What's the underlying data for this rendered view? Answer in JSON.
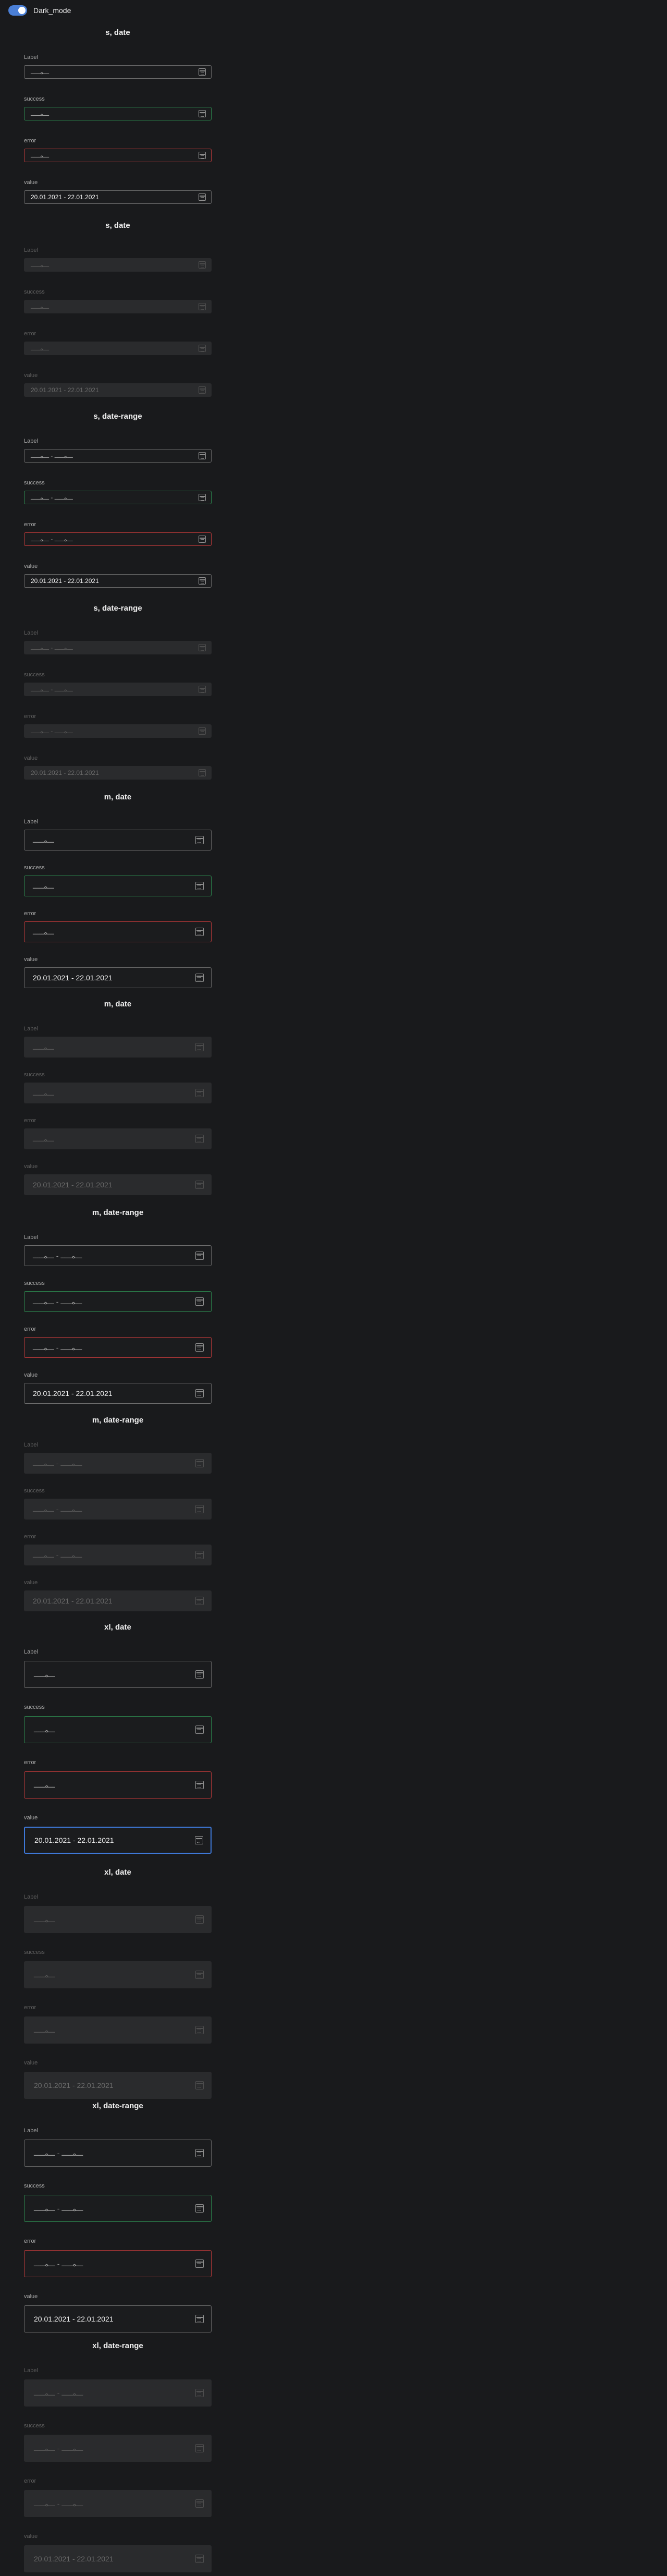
{
  "toggle": {
    "label": "Dark_mode",
    "on": true
  },
  "labels": {
    "label": "Label",
    "success": "success",
    "error": "error",
    "value": "value"
  },
  "placeholders": {
    "date": "ـــمـــــ",
    "range": "ـــمـــــ - ـــمـــــ"
  },
  "value_text": "20.01.2021 - 22.01.2021",
  "colors": {
    "accent": "#3e78d8",
    "success": "#2d8a4f",
    "error": "#c03a3a",
    "background": "#191a1c"
  },
  "icon": "calendar-icon",
  "sections": [
    {
      "title": "s, date",
      "size": "s",
      "type": "date",
      "disabled": false
    },
    {
      "title": "s, date",
      "size": "s",
      "type": "date",
      "disabled": true
    },
    {
      "title": "s, date-range",
      "size": "s",
      "type": "range",
      "disabled": false
    },
    {
      "title": "s, date-range",
      "size": "s",
      "type": "range",
      "disabled": true
    },
    {
      "title": "m, date",
      "size": "m",
      "type": "date",
      "disabled": false
    },
    {
      "title": "m, date",
      "size": "m",
      "type": "date",
      "disabled": true
    },
    {
      "title": "m, date-range",
      "size": "m",
      "type": "range",
      "disabled": false
    },
    {
      "title": "m, date-range",
      "size": "m",
      "type": "range",
      "disabled": true
    },
    {
      "title": "xl, date",
      "size": "xl",
      "type": "date",
      "disabled": false,
      "focused_value": true
    },
    {
      "title": "xl, date",
      "size": "xl",
      "type": "date",
      "disabled": true
    },
    {
      "title": "xl, date-range",
      "size": "xl",
      "type": "range",
      "disabled": false
    },
    {
      "title": "xl, date-range",
      "size": "xl",
      "type": "range",
      "disabled": true
    }
  ]
}
